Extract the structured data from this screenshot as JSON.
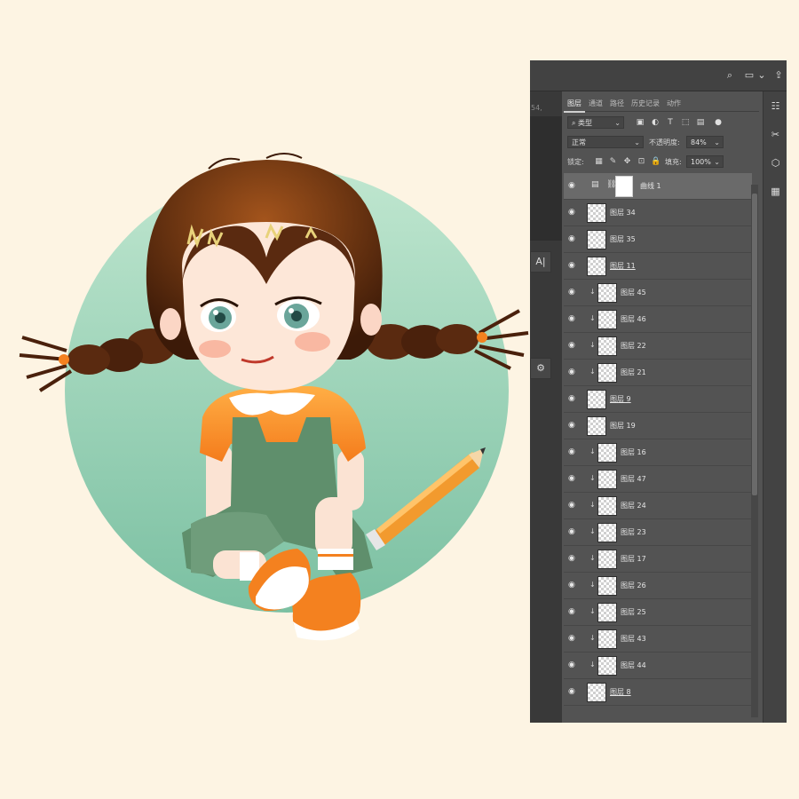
{
  "panel": {
    "tabs": [
      "图层",
      "通道",
      "路径",
      "历史记录",
      "动作"
    ],
    "active_tab": "图层",
    "doc_number_fragment": "54,",
    "left_tool_label": "A|",
    "filter_kind": "类型",
    "blend_mode": "正常",
    "opacity_label": "不透明度:",
    "opacity_value": "84%",
    "lock_label": "锁定:",
    "fill_label": "填充:",
    "fill_value": "100%"
  },
  "layers": [
    {
      "name": "曲线 1",
      "type": "adjustment",
      "selected": true
    },
    {
      "name": "图层 34",
      "clipped": false
    },
    {
      "name": "图层 35",
      "clipped": false
    },
    {
      "name": "图层 11",
      "clipped": false,
      "underline": true
    },
    {
      "name": "图层 45",
      "clipped": true
    },
    {
      "name": "图层 46",
      "clipped": true
    },
    {
      "name": "图层 22",
      "clipped": true
    },
    {
      "name": "图层 21",
      "clipped": true
    },
    {
      "name": "图层 9",
      "clipped": false,
      "underline": true
    },
    {
      "name": "图层 19",
      "clipped": false
    },
    {
      "name": "图层 16",
      "clipped": true
    },
    {
      "name": "图层 47",
      "clipped": true
    },
    {
      "name": "图层 24",
      "clipped": true
    },
    {
      "name": "图层 23",
      "clipped": true
    },
    {
      "name": "图层 17",
      "clipped": true
    },
    {
      "name": "图层 26",
      "clipped": true
    },
    {
      "name": "图层 25",
      "clipped": true
    },
    {
      "name": "图层 43",
      "clipped": true
    },
    {
      "name": "图层 44",
      "clipped": true
    },
    {
      "name": "图层 8",
      "clipped": false,
      "underline": true
    }
  ],
  "colors": {
    "background": "#fdf4e3",
    "circle_top": "#b4e2c8",
    "circle_bottom": "#7fc3a6",
    "hair": "#5a2a10",
    "shirt": "#f7902a",
    "overalls": "#5f8f6c",
    "panel_bg": "#535353"
  }
}
